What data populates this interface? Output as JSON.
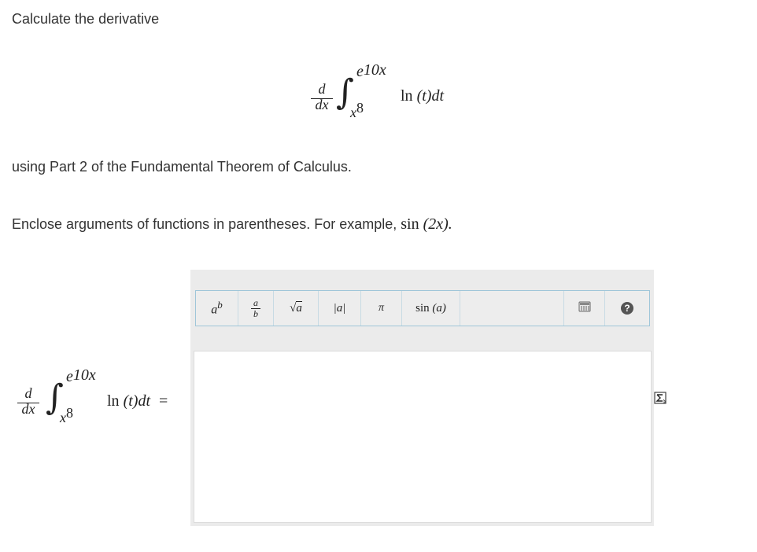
{
  "question": {
    "title": "Calculate the derivative",
    "instruction": "using Part 2 of the Fundamental Theorem of Calculus.",
    "hint_prefix": "Enclose arguments of functions in parentheses. For example, ",
    "hint_example": "sin (2x).",
    "hint_example_fn": "sin",
    "hint_example_arg": "(2x)."
  },
  "formula": {
    "d": "d",
    "dx": "dx",
    "upper_base": "e",
    "upper_exp": "10x",
    "lower_base": "x",
    "lower_exp": "8",
    "integrand_fn": "ln",
    "integrand_rest": "(t)dt"
  },
  "answer_row": {
    "equals": "="
  },
  "toolbar": {
    "power": {
      "base": "a",
      "exp": "b"
    },
    "fraction": {
      "num": "a",
      "den": "b"
    },
    "sqrt": {
      "arg": "a"
    },
    "abs": "|a|",
    "pi": "π",
    "sin": {
      "fn": "sin",
      "arg": "(a)"
    },
    "keyboard_icon": "keyboard-icon",
    "help_icon": "help-icon",
    "help_label": "?"
  },
  "answer_input": {
    "value": ""
  },
  "side_icon": "equation-editor-icon",
  "colors": {
    "toolbar_border": "#9fc6d9",
    "editor_bg": "#ebebeb",
    "text": "#333333"
  }
}
